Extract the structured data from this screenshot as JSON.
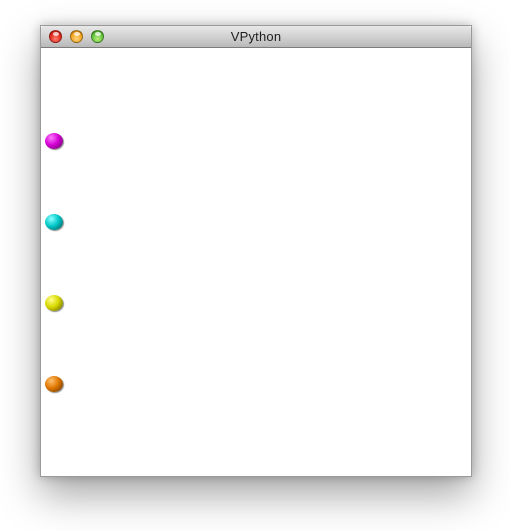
{
  "window": {
    "title": "VPython",
    "controls": [
      {
        "name": "close",
        "color": "#e0261a"
      },
      {
        "name": "minimize",
        "color": "#f0a21b"
      },
      {
        "name": "zoom",
        "color": "#5fc13a"
      }
    ]
  },
  "scene": {
    "background": "#ffffff",
    "spheres": [
      {
        "color": "#d400d4",
        "highlight": "#ff7bff",
        "shade": "#5a005a"
      },
      {
        "color": "#00c8c8",
        "highlight": "#8cffff",
        "shade": "#005050"
      },
      {
        "color": "#d8d800",
        "highlight": "#ffff8a",
        "shade": "#5a5a00"
      },
      {
        "color": "#e07800",
        "highlight": "#ffc070",
        "shade": "#5c2c00"
      }
    ]
  }
}
